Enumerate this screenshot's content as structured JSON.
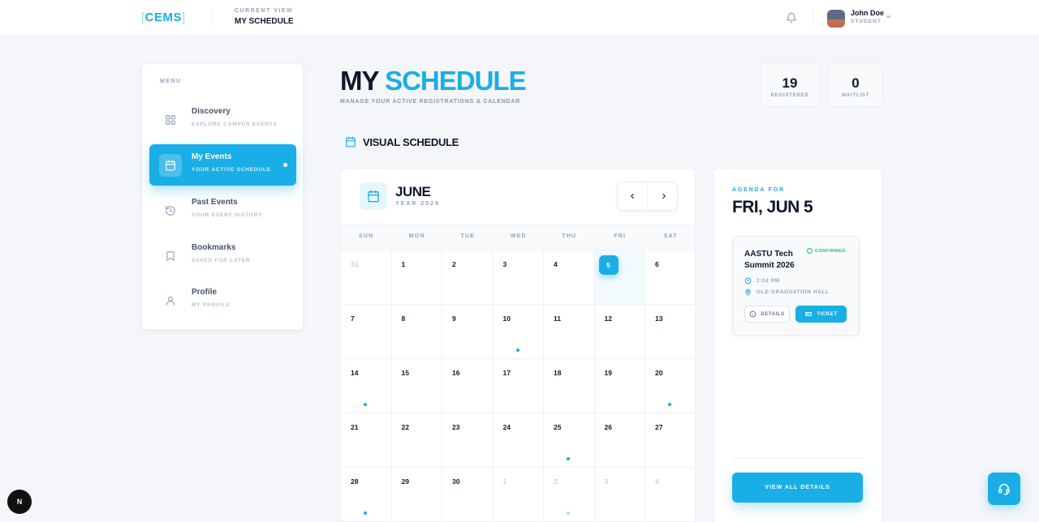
{
  "header": {
    "logo": "CEMS",
    "current_view_label": "CURRENT VIEW",
    "current_view": "MY SCHEDULE",
    "user_name": "John Doe",
    "user_role": "STUDENT"
  },
  "sidebar": {
    "menu_label": "MENU",
    "items": [
      {
        "title": "Discovery",
        "subtitle": "EXPLORE CAMPUS EVENTS",
        "icon": "grid-icon"
      },
      {
        "title": "My Events",
        "subtitle": "YOUR ACTIVE SCHEDULE",
        "icon": "calendar-icon",
        "active": true
      },
      {
        "title": "Past Events",
        "subtitle": "YOUR EVENT HISTORY",
        "icon": "history-icon"
      },
      {
        "title": "Bookmarks",
        "subtitle": "SAVED FOR LATER",
        "icon": "bookmark-icon"
      },
      {
        "title": "Profile",
        "subtitle": "MY PROFILE",
        "icon": "user-icon"
      }
    ]
  },
  "main": {
    "title_part1": "MY",
    "title_part2": "SCHEDULE",
    "subtitle": "MANAGE YOUR ACTIVE REGISTRATIONS & CALENDAR",
    "stats": [
      {
        "value": "19",
        "label": "REGISTERED"
      },
      {
        "value": "0",
        "label": "WAITLIST"
      }
    ],
    "section_title": "VISUAL SCHEDULE"
  },
  "calendar": {
    "month": "JUNE",
    "year_label": "YEAR 2026",
    "weekdays": [
      "SUN",
      "MON",
      "TUE",
      "WED",
      "THU",
      "FRI",
      "SAT"
    ],
    "days": [
      {
        "n": "31",
        "muted": true
      },
      {
        "n": "1"
      },
      {
        "n": "2"
      },
      {
        "n": "3"
      },
      {
        "n": "4"
      },
      {
        "n": "5",
        "selected": true
      },
      {
        "n": "6"
      },
      {
        "n": "7"
      },
      {
        "n": "8"
      },
      {
        "n": "9"
      },
      {
        "n": "10",
        "dot": true
      },
      {
        "n": "11"
      },
      {
        "n": "12"
      },
      {
        "n": "13"
      },
      {
        "n": "14",
        "dot": true
      },
      {
        "n": "15"
      },
      {
        "n": "16"
      },
      {
        "n": "17"
      },
      {
        "n": "18"
      },
      {
        "n": "19"
      },
      {
        "n": "20",
        "dot": true
      },
      {
        "n": "21"
      },
      {
        "n": "22"
      },
      {
        "n": "23"
      },
      {
        "n": "24"
      },
      {
        "n": "25",
        "dot": true
      },
      {
        "n": "26"
      },
      {
        "n": "27"
      },
      {
        "n": "28",
        "dot": true
      },
      {
        "n": "29"
      },
      {
        "n": "30"
      },
      {
        "n": "1",
        "muted": true
      },
      {
        "n": "2",
        "muted": true,
        "dot": true
      },
      {
        "n": "3",
        "muted": true
      },
      {
        "n": "4",
        "muted": true
      }
    ]
  },
  "agenda": {
    "label": "AGENDA FOR",
    "date": "FRI, JUN 5",
    "event": {
      "title": "AASTU Tech Summit 2026",
      "status": "CONFIRMED",
      "time": "2:02 PM",
      "location": "OLD GRADUATION HALL",
      "details_label": "DETAILS",
      "ticket_label": "TICKET"
    },
    "view_all_label": "VIEW ALL DETAILS"
  },
  "floating": {
    "next_badge": "N"
  },
  "colors": {
    "accent": "#1aaee6",
    "confirmed": "#22c55e",
    "text": "#0f172a"
  }
}
